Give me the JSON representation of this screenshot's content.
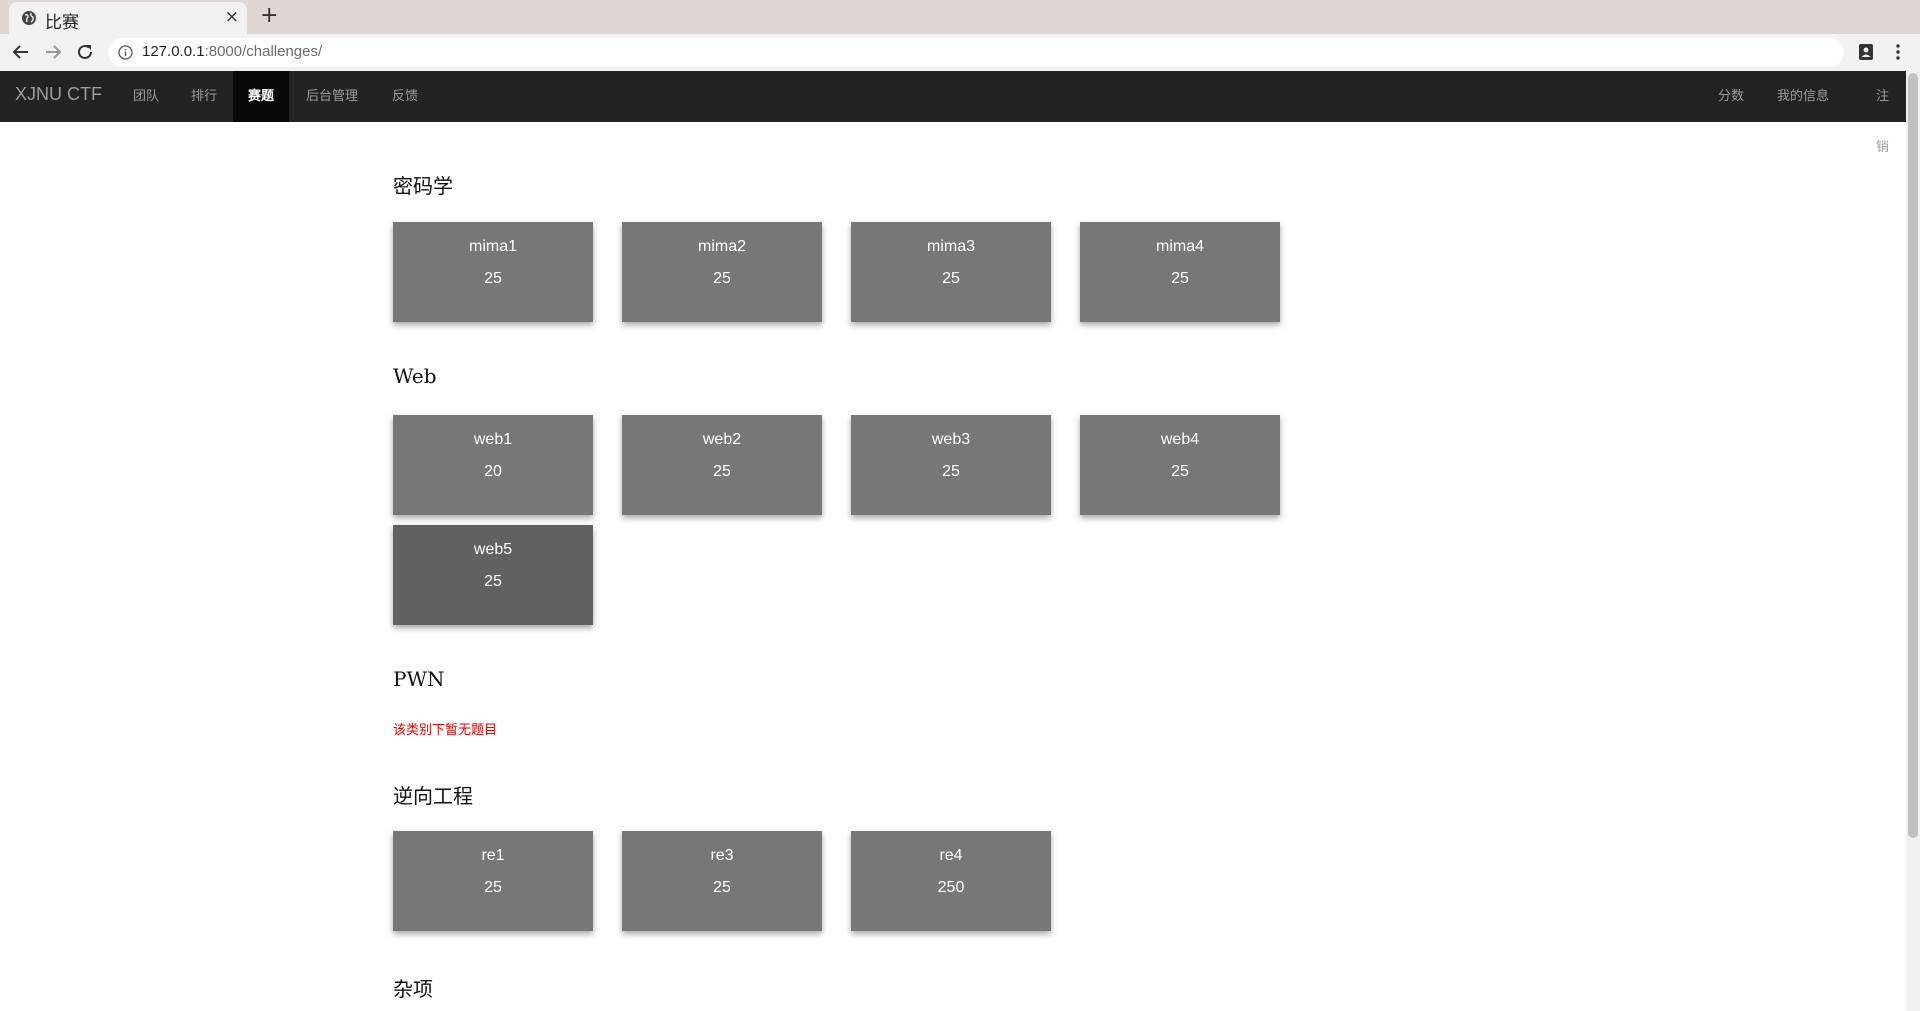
{
  "browser": {
    "tab_title": "比赛",
    "tab_close": "×",
    "new_tab": "+",
    "url_host": "127.0.0.1",
    "url_rest": ":8000/challenges/"
  },
  "navbar": {
    "brand": "XJNU CTF",
    "left_items": [
      {
        "label": "团队",
        "active": false
      },
      {
        "label": "排行",
        "active": false
      },
      {
        "label": "赛题",
        "active": true
      },
      {
        "label": "后台管理",
        "active": false
      },
      {
        "label": "反馈",
        "active": false
      }
    ],
    "right_items": [
      {
        "label": "分数"
      },
      {
        "label": "我的信息"
      },
      {
        "label": "注销"
      }
    ]
  },
  "categories": [
    {
      "title": "密码学",
      "challenges": [
        {
          "name": "mima1",
          "score": "25"
        },
        {
          "name": "mima2",
          "score": "25"
        },
        {
          "name": "mima3",
          "score": "25"
        },
        {
          "name": "mima4",
          "score": "25"
        }
      ]
    },
    {
      "title": "Web",
      "challenges": [
        {
          "name": "web1",
          "score": "20"
        },
        {
          "name": "web2",
          "score": "25"
        },
        {
          "name": "web3",
          "score": "25"
        },
        {
          "name": "web4",
          "score": "25"
        },
        {
          "name": "web5",
          "score": "25"
        }
      ]
    },
    {
      "title": "PWN",
      "empty_message": "该类别下暂无题目",
      "challenges": []
    },
    {
      "title": "逆向工程",
      "challenges": [
        {
          "name": "re1",
          "score": "25"
        },
        {
          "name": "re3",
          "score": "25"
        },
        {
          "name": "re4",
          "score": "250"
        }
      ]
    },
    {
      "title": "杂项",
      "challenges": []
    }
  ],
  "icons": {
    "favicon": "globe-icon",
    "back": "arrow-left-icon",
    "forward": "arrow-right-icon",
    "reload": "reload-icon",
    "info": "info-icon",
    "account": "account-icon",
    "menu": "kebab-menu-icon"
  }
}
